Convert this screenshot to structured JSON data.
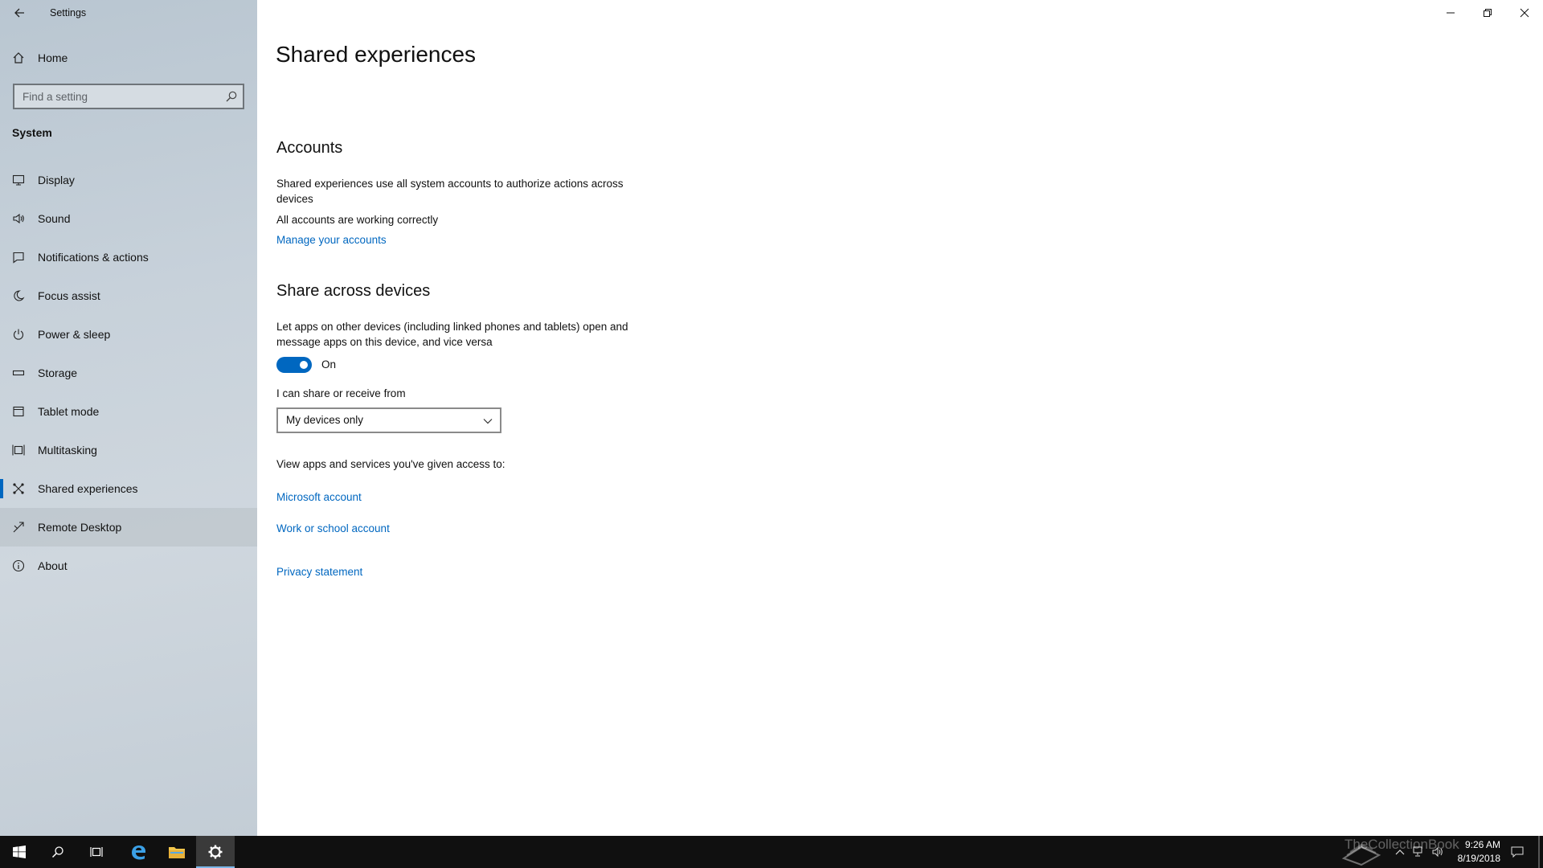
{
  "window": {
    "app_title": "Settings"
  },
  "sidebar": {
    "home_label": "Home",
    "search_placeholder": "Find a setting",
    "section_label": "System",
    "items": [
      {
        "label": "Display",
        "icon": "display-icon"
      },
      {
        "label": "Sound",
        "icon": "speaker-icon"
      },
      {
        "label": "Notifications & actions",
        "icon": "notification-icon"
      },
      {
        "label": "Focus assist",
        "icon": "moon-icon"
      },
      {
        "label": "Power & sleep",
        "icon": "power-icon"
      },
      {
        "label": "Storage",
        "icon": "storage-icon"
      },
      {
        "label": "Tablet mode",
        "icon": "tablet-icon"
      },
      {
        "label": "Multitasking",
        "icon": "multitasking-icon"
      },
      {
        "label": "Shared experiences",
        "icon": "shared-icon",
        "selected": true
      },
      {
        "label": "Remote Desktop",
        "icon": "remote-icon",
        "hover": true
      },
      {
        "label": "About",
        "icon": "info-icon"
      }
    ]
  },
  "main": {
    "page_title": "Shared experiences",
    "accounts": {
      "heading": "Accounts",
      "description": "Shared experiences use all system accounts to authorize actions across devices",
      "status": "All accounts are working correctly",
      "manage_link": "Manage your accounts"
    },
    "share": {
      "heading": "Share across devices",
      "description": "Let apps on other devices (including linked phones and tablets) open and message apps on this device, and vice versa",
      "toggle_state": "On",
      "toggle_on": true,
      "dropdown_label": "I can share or receive from",
      "dropdown_value": "My devices only",
      "access_label": "View apps and services you've given access to:",
      "links": [
        "Microsoft account",
        "Work or school account"
      ],
      "privacy_link": "Privacy statement"
    }
  },
  "taskbar": {
    "time": "9:26 AM",
    "date": "8/19/2018",
    "watermark": "TheCollectionBook",
    "apps": [
      "start-icon",
      "search-icon",
      "task-view-icon",
      "edge-icon",
      "file-explorer-icon",
      "settings-gear-icon"
    ]
  },
  "colors": {
    "accent": "#0067c0",
    "taskbar": "#101010"
  }
}
